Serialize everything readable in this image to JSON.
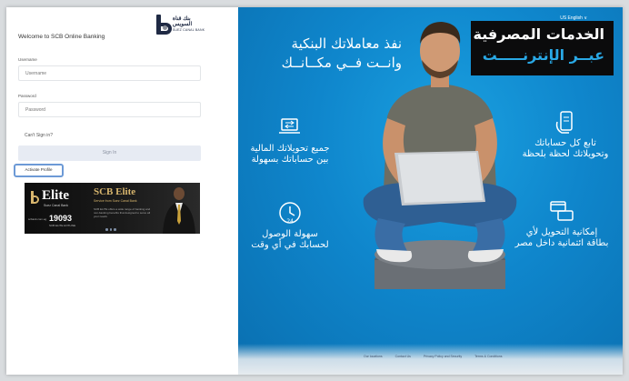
{
  "login": {
    "bank_logo_ar": "بنك قناة السويس",
    "bank_logo_en": "SUEZ CANAL BANK",
    "welcome": "Welcome to SCB Online Banking",
    "username_label": "Username",
    "username_placeholder": "Username",
    "password_label": "Password",
    "password_placeholder": "Password",
    "cant_sign_in": "Can't Sign in?",
    "sign_in": "Sign In",
    "activate_profile": "Activate Profile"
  },
  "banner": {
    "elite": "Elite",
    "bank_name": "Suez Canal Bank",
    "phone": "19093",
    "small_left": "scbank.com.eg",
    "small_bottom": "SCB ELITE HOTLINE",
    "title": "SCB Elite",
    "tagline": "Service from Suez Canal Bank",
    "description": "SCB ELITE offers a wide range of banking and non-banking benefits that designed to serve all your needs"
  },
  "hero": {
    "language": "US English ∨",
    "title_line1": "الخدمات المصرفية",
    "title_line2": "عبــر الإنترنـــــت",
    "slogan_line1": "نفذ معاملاتك البنكية",
    "slogan_line2": "وانــت فــي مكــانــك",
    "features": [
      {
        "icon": "hand-phone-icon",
        "line1": "تابع كل حساباتك",
        "line2": "وتحويلاتك لحظة بلحظة"
      },
      {
        "icon": "laptop-transfer-icon",
        "line1": "جميع تحويلاتك المالية",
        "line2": "بين حساباتك بسهولة"
      },
      {
        "icon": "clock-24-icon",
        "line1": "سهولة الوصول",
        "line2": "لحسابك في أي وقت"
      },
      {
        "icon": "card-transfer-icon",
        "line1": "إمكانية التحويل لأي",
        "line2": "بطاقة ائتمانية داخل مصر"
      }
    ],
    "footer": [
      "Our locations",
      "Contact Us",
      "Privacy Policy and Security",
      "Terms & Conditions"
    ]
  },
  "colors": {
    "hero_blue": "#0f86cc",
    "title_accent": "#29a8e5",
    "activate_outline": "#6d9ad6",
    "signin_bg": "#e7ebf3",
    "elite_gold": "#d7b56d"
  }
}
